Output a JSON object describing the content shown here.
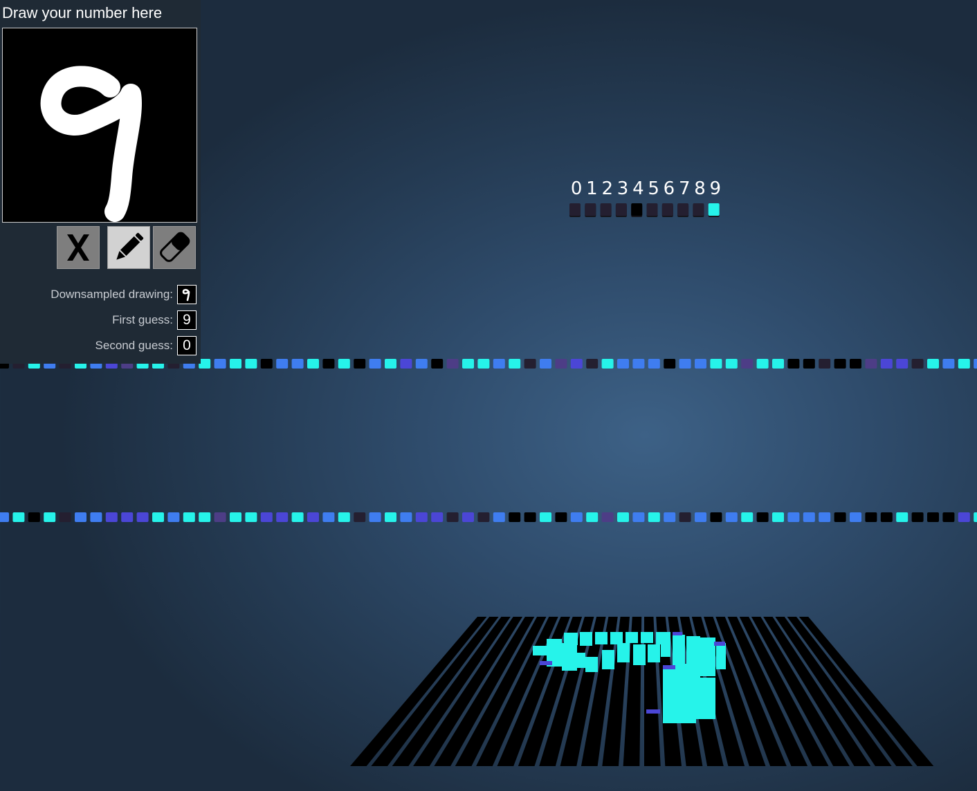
{
  "panel": {
    "title": "Draw your number here",
    "tools": {
      "clear_icon": "x-icon",
      "pencil_icon": "pencil-icon",
      "eraser_icon": "eraser-icon",
      "active": "pencil"
    },
    "downsampled_label": "Downsampled drawing:",
    "first_guess_label": "First guess:",
    "first_guess_value": "9",
    "second_guess_label": "Second guess:",
    "second_guess_value": "0"
  },
  "output": {
    "labels": [
      "0",
      "1",
      "2",
      "3",
      "4",
      "5",
      "6",
      "7",
      "8",
      "9"
    ],
    "activations": [
      0.05,
      0.04,
      0.05,
      0.04,
      0.0,
      0.06,
      0.05,
      0.05,
      0.08,
      1.0
    ]
  },
  "colors": {
    "cyan": "#26f3ea",
    "blue": "#3f7df0",
    "indigo": "#4b46d6",
    "purple": "#4d3d86",
    "dark": "#241f30",
    "black": "#000000"
  }
}
